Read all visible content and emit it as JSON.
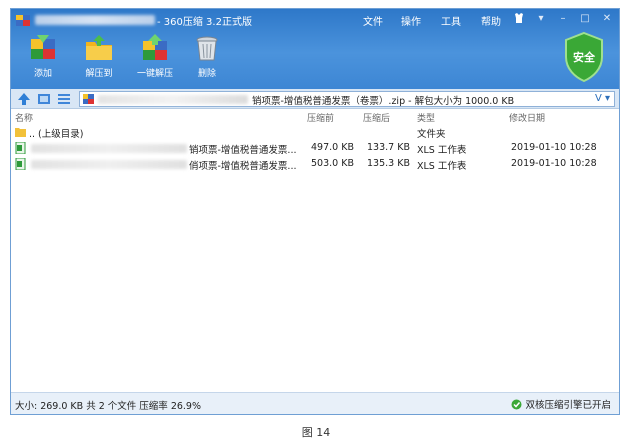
{
  "window": {
    "title": "- 360压缩 3.2正式版",
    "menu": [
      "文件",
      "操作",
      "工具",
      "帮助"
    ]
  },
  "toolbar": {
    "add_label": "添加",
    "extract_to_label": "解压到",
    "one_click_extract_label": "一键解压",
    "delete_label": "删除",
    "security_label": "安全"
  },
  "address": {
    "path_text": "销项票-增值税普通发票（卷票）.zip - 解包大小为 1000.0 KB",
    "dropdown_label": "V"
  },
  "columns": {
    "name": "名称",
    "compressed_before": "压缩前",
    "compressed_after": "压缩后",
    "type": "类型",
    "modified": "修改日期"
  },
  "rows": [
    {
      "name": ".. (上级目录)",
      "before": "",
      "after": "",
      "type": "文件夹",
      "modified": ""
    },
    {
      "name": "销项票-增值税普通发票...",
      "before": "497.0 KB",
      "after": "133.7 KB",
      "type": "XLS 工作表",
      "modified": "2019-01-10 10:28"
    },
    {
      "name": "俏项票-增值税普通发票...",
      "before": "503.0 KB",
      "after": "135.3 KB",
      "type": "XLS 工作表",
      "modified": "2019-01-10 10:28"
    }
  ],
  "status": {
    "summary": "大小: 269.0 KB 共 2 个文件 压缩率 26.9%",
    "engine": "双核压缩引擎已开启"
  },
  "caption": "图 14",
  "colors": {
    "toolbar_blue": "#3d86d4",
    "shield_green": "#3aa836",
    "address_bg": "#d8e6f5"
  }
}
